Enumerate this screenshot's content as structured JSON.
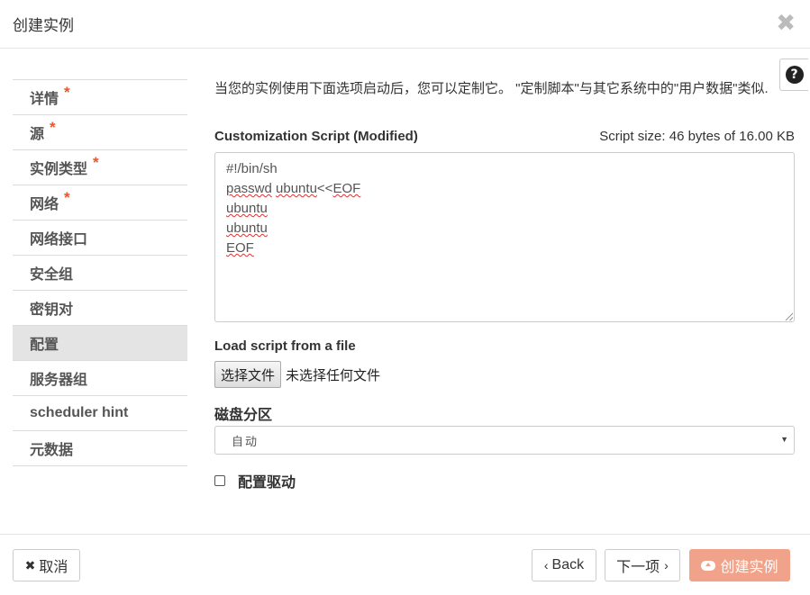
{
  "modal": {
    "title": "创建实例",
    "close_symbol": "✖"
  },
  "help": {
    "icon": "question-circle-icon",
    "symbol": "?"
  },
  "sidebar": {
    "items": [
      {
        "label": "详情",
        "required": true,
        "required_mark": "*"
      },
      {
        "label": "源",
        "required": true,
        "required_mark": "*"
      },
      {
        "label": "实例类型",
        "required": true,
        "required_mark": "*"
      },
      {
        "label": "网络",
        "required": true,
        "required_mark": "*"
      },
      {
        "label": "网络接口",
        "required": false
      },
      {
        "label": "安全组",
        "required": false
      },
      {
        "label": "密钥对",
        "required": false
      },
      {
        "label": "配置",
        "required": false,
        "active": true
      },
      {
        "label": "服务器组",
        "required": false
      },
      {
        "label": "scheduler hint",
        "required": false
      },
      {
        "label": "元数据",
        "required": false
      }
    ]
  },
  "content": {
    "description": "当您的实例使用下面选项启动后，您可以定制它。 \"定制脚本\"与其它系统中的\"用户数据\"类似.",
    "script_label": "Customization Script (Modified)",
    "script_size": "Script size: 46 bytes of 16.00 KB",
    "script_lines": [
      "#!/bin/sh",
      "passwd ubuntu<<EOF",
      "ubuntu",
      "ubuntu",
      "EOF"
    ],
    "load_label": "Load script from a file",
    "file_button": "选择文件",
    "file_status": "未选择任何文件",
    "disk_label": "磁盘分区",
    "disk_value": "自动",
    "driver_label": "配置驱动",
    "driver_checked": false
  },
  "footer": {
    "cancel": "取消",
    "back": "Back",
    "next": "下一项",
    "create": "创建实例"
  },
  "colors": {
    "required_star": "#e8562a",
    "create_button_bg": "#f0a38a",
    "active_nav_bg": "#e4e4e4"
  }
}
